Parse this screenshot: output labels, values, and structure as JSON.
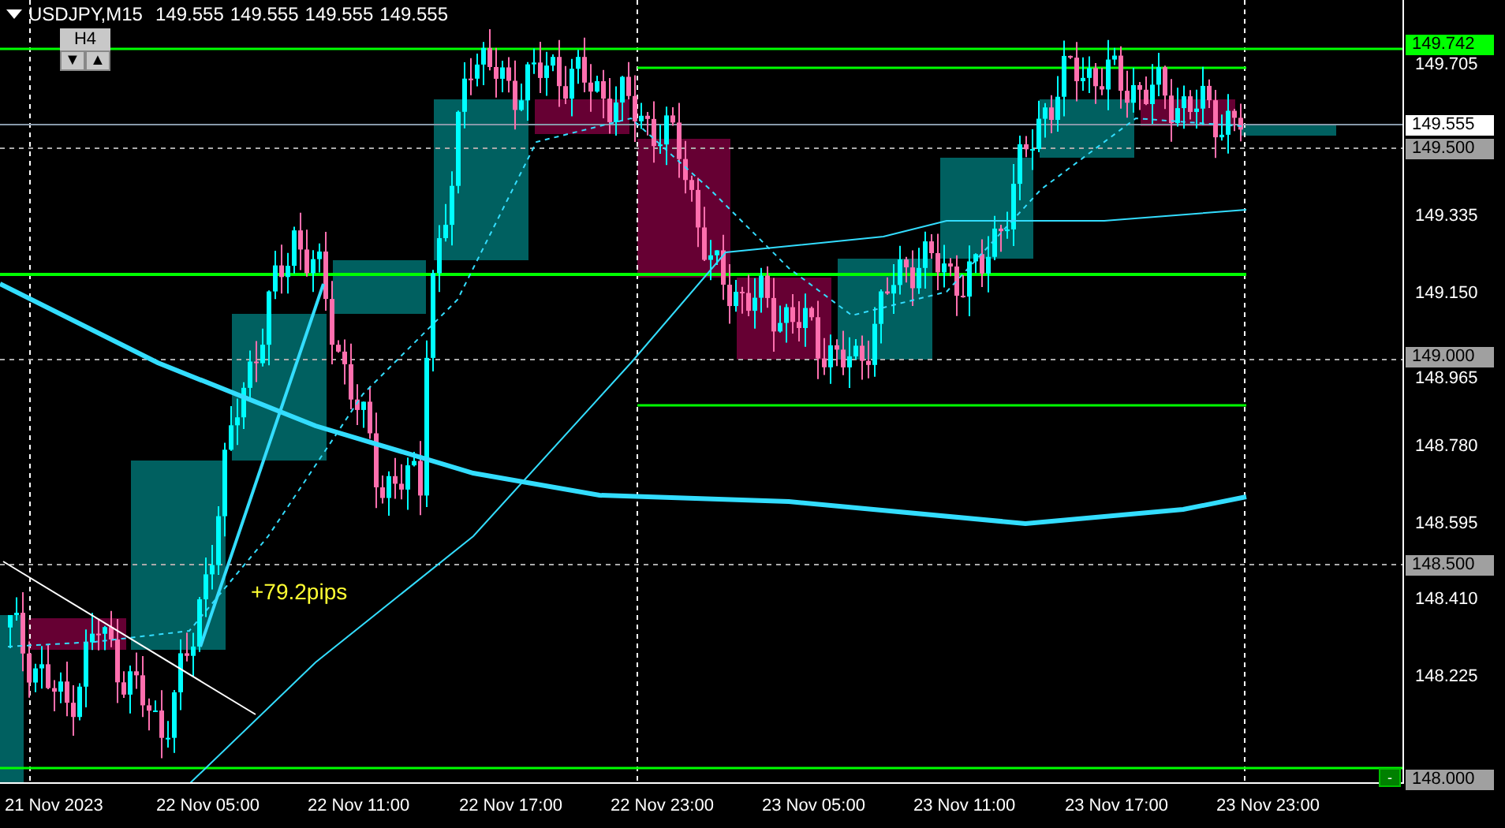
{
  "header": {
    "symbol": "USDJPY,M15",
    "prices": [
      "149.555",
      "149.555",
      "149.555",
      "149.555"
    ]
  },
  "timeframe_button": {
    "label": "H4"
  },
  "arrow_buttons": [
    "▼",
    "▲"
  ],
  "annotation": "+79.2pips",
  "corner_button": "-",
  "price_ticks": [
    "149.705",
    "149.335",
    "149.150",
    "148.965",
    "148.780",
    "148.595",
    "148.410",
    "148.225"
  ],
  "price_tags": [
    {
      "text": "149.742",
      "kind": "line"
    },
    {
      "text": "149.555",
      "kind": "bid"
    },
    {
      "text": "149.500",
      "kind": "level"
    },
    {
      "text": "149.000",
      "kind": "level"
    },
    {
      "text": "148.500",
      "kind": "level"
    },
    {
      "text": "148.000",
      "kind": "level"
    }
  ],
  "time_labels": [
    "21 Nov 2023",
    "22 Nov 05:00",
    "22 Nov 11:00",
    "22 Nov 17:00",
    "22 Nov 23:00",
    "23 Nov 05:00",
    "23 Nov 11:00",
    "23 Nov 17:00",
    "23 Nov 23:00"
  ]
}
